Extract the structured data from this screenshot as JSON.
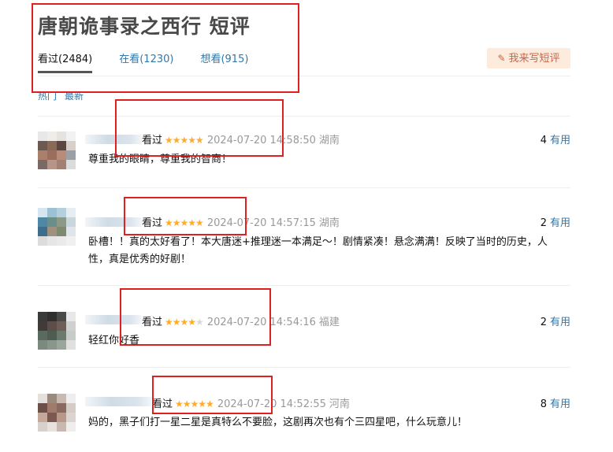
{
  "header": {
    "title": "唐朝诡事录之西行 短评",
    "tabs": [
      {
        "label": "看过(2484)",
        "active": true
      },
      {
        "label": "在看(1230)",
        "active": false
      },
      {
        "label": "想看(915)",
        "active": false
      }
    ],
    "write_button": "我来写短评",
    "write_icon": "pencil-icon"
  },
  "sort": {
    "hot": "热门",
    "latest": "最新"
  },
  "reviews": [
    {
      "status": "看过",
      "rating": 5,
      "stars_full": "★★★★★",
      "stars_empty": "",
      "time": "2024-07-20 14:58:50",
      "location": "湖南",
      "useful_count": "4",
      "useful_label": "有用",
      "content": "尊重我的眼睛，尊重我的智商！"
    },
    {
      "status": "看过",
      "rating": 5,
      "stars_full": "★★★★★",
      "stars_empty": "",
      "time": "2024-07-20 14:57:15",
      "location": "湖南",
      "useful_count": "2",
      "useful_label": "有用",
      "content": "卧槽！！真的太好看了！本大唐迷+推理迷一本满足～！剧情紧凑！悬念满满！反映了当时的历史，人性，真是优秀的好剧！"
    },
    {
      "status": "看过",
      "rating": 4,
      "stars_full": "★★★★",
      "stars_empty": "★",
      "time": "2024-07-20 14:54:16",
      "location": "福建",
      "useful_count": "2",
      "useful_label": "有用",
      "content": "轻红你好香"
    },
    {
      "status": "看过",
      "rating": 5,
      "stars_full": "★★★★★",
      "stars_empty": "",
      "time": "2024-07-20 14:52:55",
      "location": "河南",
      "useful_count": "8",
      "useful_label": "有用",
      "content": "妈的，黑子们打一星二星是真特么不要脸，这剧再次也有个三四星吧，什么玩意儿！"
    }
  ],
  "colors": {
    "link": "#3377aa",
    "star": "#ffac2d",
    "highlight": "#e02020",
    "button_bg": "#fdecde",
    "button_text": "#ca6445"
  }
}
